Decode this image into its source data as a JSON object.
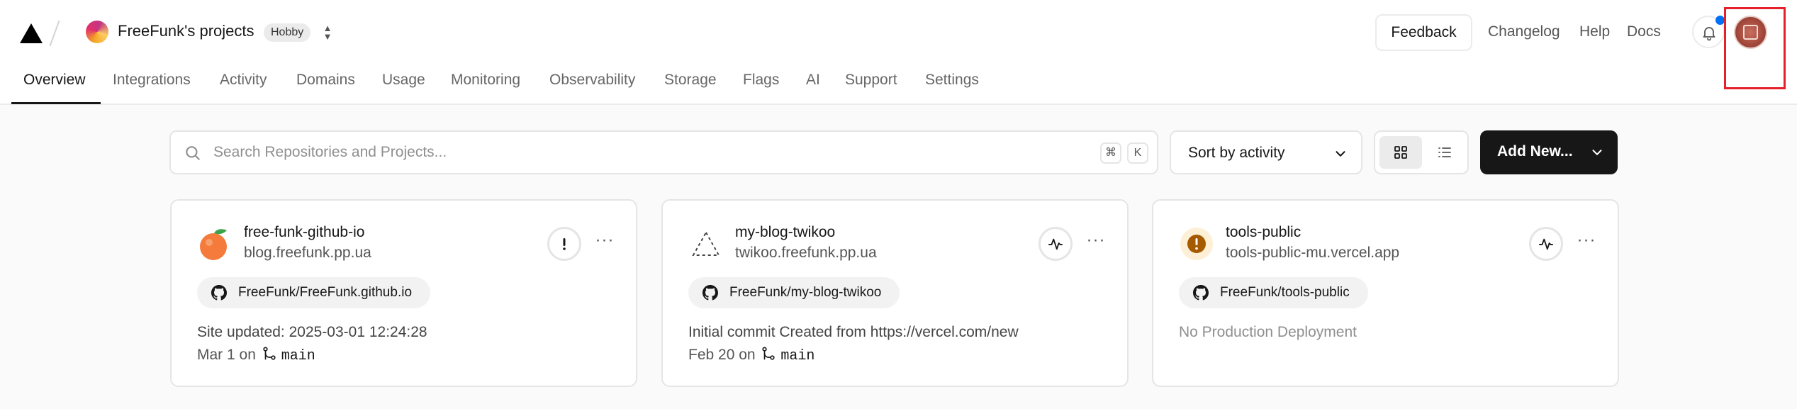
{
  "header": {
    "team_name": "FreeFunk's projects",
    "plan_badge": "Hobby",
    "feedback_label": "Feedback",
    "links": [
      "Changelog",
      "Help",
      "Docs"
    ]
  },
  "tabs": [
    {
      "label": "Overview",
      "active": true
    },
    {
      "label": "Integrations"
    },
    {
      "label": "Activity"
    },
    {
      "label": "Domains"
    },
    {
      "label": "Usage"
    },
    {
      "label": "Monitoring"
    },
    {
      "label": "Observability"
    },
    {
      "label": "Storage"
    },
    {
      "label": "Flags"
    },
    {
      "label": "AI"
    },
    {
      "label": "Support"
    },
    {
      "label": "Settings"
    }
  ],
  "toolbar": {
    "search_placeholder": "Search Repositories and Projects...",
    "shortcut_keys": [
      "⌘",
      "K"
    ],
    "sort_label": "Sort by activity",
    "add_new_label": "Add New..."
  },
  "projects": [
    {
      "name": "free-funk-github-io",
      "url": "blog.freefunk.pp.ua",
      "repo": "FreeFunk/FreeFunk.github.io",
      "commit_message": "Site updated: 2025-03-01 12:24:28",
      "date_prefix": "Mar 1 on",
      "branch": "main",
      "status_icon": "exclamation-icon",
      "project_icon": "orange-fruit-icon"
    },
    {
      "name": "my-blog-twikoo",
      "url": "twikoo.freefunk.pp.ua",
      "repo": "FreeFunk/my-blog-twikoo",
      "commit_message": "Initial commit Created from https://vercel.com/new",
      "date_prefix": "Feb 20 on",
      "branch": "main",
      "status_icon": "activity-pulse-icon",
      "project_icon": "dashed-triangle-icon"
    },
    {
      "name": "tools-public",
      "url": "tools-public-mu.vercel.app",
      "repo": "FreeFunk/tools-public",
      "no_deployment_text": "No Production Deployment",
      "status_icon": "activity-pulse-icon",
      "project_icon": "warning-circle-icon"
    }
  ],
  "colors": {
    "accent_dark": "#171717",
    "notification_dot": "#0070f3",
    "highlight_box": "#e5202b"
  }
}
